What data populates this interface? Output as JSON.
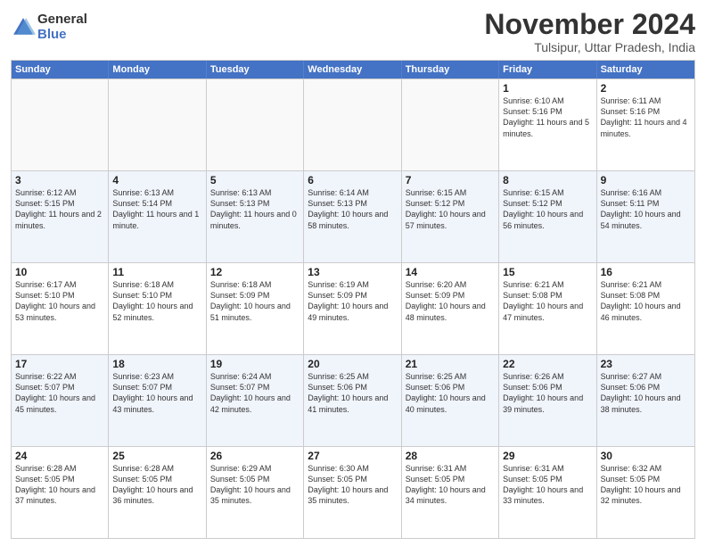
{
  "header": {
    "logo_general": "General",
    "logo_blue": "Blue",
    "month_title": "November 2024",
    "location": "Tulsipur, Uttar Pradesh, India"
  },
  "days_of_week": [
    "Sunday",
    "Monday",
    "Tuesday",
    "Wednesday",
    "Thursday",
    "Friday",
    "Saturday"
  ],
  "rows": [
    {
      "alt": false,
      "cells": [
        {
          "day": "",
          "empty": true
        },
        {
          "day": "",
          "empty": true
        },
        {
          "day": "",
          "empty": true
        },
        {
          "day": "",
          "empty": true
        },
        {
          "day": "",
          "empty": true
        },
        {
          "day": "1",
          "sunrise": "Sunrise: 6:10 AM",
          "sunset": "Sunset: 5:16 PM",
          "daylight": "Daylight: 11 hours and 5 minutes."
        },
        {
          "day": "2",
          "sunrise": "Sunrise: 6:11 AM",
          "sunset": "Sunset: 5:16 PM",
          "daylight": "Daylight: 11 hours and 4 minutes."
        }
      ]
    },
    {
      "alt": true,
      "cells": [
        {
          "day": "3",
          "sunrise": "Sunrise: 6:12 AM",
          "sunset": "Sunset: 5:15 PM",
          "daylight": "Daylight: 11 hours and 2 minutes."
        },
        {
          "day": "4",
          "sunrise": "Sunrise: 6:13 AM",
          "sunset": "Sunset: 5:14 PM",
          "daylight": "Daylight: 11 hours and 1 minute."
        },
        {
          "day": "5",
          "sunrise": "Sunrise: 6:13 AM",
          "sunset": "Sunset: 5:13 PM",
          "daylight": "Daylight: 11 hours and 0 minutes."
        },
        {
          "day": "6",
          "sunrise": "Sunrise: 6:14 AM",
          "sunset": "Sunset: 5:13 PM",
          "daylight": "Daylight: 10 hours and 58 minutes."
        },
        {
          "day": "7",
          "sunrise": "Sunrise: 6:15 AM",
          "sunset": "Sunset: 5:12 PM",
          "daylight": "Daylight: 10 hours and 57 minutes."
        },
        {
          "day": "8",
          "sunrise": "Sunrise: 6:15 AM",
          "sunset": "Sunset: 5:12 PM",
          "daylight": "Daylight: 10 hours and 56 minutes."
        },
        {
          "day": "9",
          "sunrise": "Sunrise: 6:16 AM",
          "sunset": "Sunset: 5:11 PM",
          "daylight": "Daylight: 10 hours and 54 minutes."
        }
      ]
    },
    {
      "alt": false,
      "cells": [
        {
          "day": "10",
          "sunrise": "Sunrise: 6:17 AM",
          "sunset": "Sunset: 5:10 PM",
          "daylight": "Daylight: 10 hours and 53 minutes."
        },
        {
          "day": "11",
          "sunrise": "Sunrise: 6:18 AM",
          "sunset": "Sunset: 5:10 PM",
          "daylight": "Daylight: 10 hours and 52 minutes."
        },
        {
          "day": "12",
          "sunrise": "Sunrise: 6:18 AM",
          "sunset": "Sunset: 5:09 PM",
          "daylight": "Daylight: 10 hours and 51 minutes."
        },
        {
          "day": "13",
          "sunrise": "Sunrise: 6:19 AM",
          "sunset": "Sunset: 5:09 PM",
          "daylight": "Daylight: 10 hours and 49 minutes."
        },
        {
          "day": "14",
          "sunrise": "Sunrise: 6:20 AM",
          "sunset": "Sunset: 5:09 PM",
          "daylight": "Daylight: 10 hours and 48 minutes."
        },
        {
          "day": "15",
          "sunrise": "Sunrise: 6:21 AM",
          "sunset": "Sunset: 5:08 PM",
          "daylight": "Daylight: 10 hours and 47 minutes."
        },
        {
          "day": "16",
          "sunrise": "Sunrise: 6:21 AM",
          "sunset": "Sunset: 5:08 PM",
          "daylight": "Daylight: 10 hours and 46 minutes."
        }
      ]
    },
    {
      "alt": true,
      "cells": [
        {
          "day": "17",
          "sunrise": "Sunrise: 6:22 AM",
          "sunset": "Sunset: 5:07 PM",
          "daylight": "Daylight: 10 hours and 45 minutes."
        },
        {
          "day": "18",
          "sunrise": "Sunrise: 6:23 AM",
          "sunset": "Sunset: 5:07 PM",
          "daylight": "Daylight: 10 hours and 43 minutes."
        },
        {
          "day": "19",
          "sunrise": "Sunrise: 6:24 AM",
          "sunset": "Sunset: 5:07 PM",
          "daylight": "Daylight: 10 hours and 42 minutes."
        },
        {
          "day": "20",
          "sunrise": "Sunrise: 6:25 AM",
          "sunset": "Sunset: 5:06 PM",
          "daylight": "Daylight: 10 hours and 41 minutes."
        },
        {
          "day": "21",
          "sunrise": "Sunrise: 6:25 AM",
          "sunset": "Sunset: 5:06 PM",
          "daylight": "Daylight: 10 hours and 40 minutes."
        },
        {
          "day": "22",
          "sunrise": "Sunrise: 6:26 AM",
          "sunset": "Sunset: 5:06 PM",
          "daylight": "Daylight: 10 hours and 39 minutes."
        },
        {
          "day": "23",
          "sunrise": "Sunrise: 6:27 AM",
          "sunset": "Sunset: 5:06 PM",
          "daylight": "Daylight: 10 hours and 38 minutes."
        }
      ]
    },
    {
      "alt": false,
      "cells": [
        {
          "day": "24",
          "sunrise": "Sunrise: 6:28 AM",
          "sunset": "Sunset: 5:05 PM",
          "daylight": "Daylight: 10 hours and 37 minutes."
        },
        {
          "day": "25",
          "sunrise": "Sunrise: 6:28 AM",
          "sunset": "Sunset: 5:05 PM",
          "daylight": "Daylight: 10 hours and 36 minutes."
        },
        {
          "day": "26",
          "sunrise": "Sunrise: 6:29 AM",
          "sunset": "Sunset: 5:05 PM",
          "daylight": "Daylight: 10 hours and 35 minutes."
        },
        {
          "day": "27",
          "sunrise": "Sunrise: 6:30 AM",
          "sunset": "Sunset: 5:05 PM",
          "daylight": "Daylight: 10 hours and 35 minutes."
        },
        {
          "day": "28",
          "sunrise": "Sunrise: 6:31 AM",
          "sunset": "Sunset: 5:05 PM",
          "daylight": "Daylight: 10 hours and 34 minutes."
        },
        {
          "day": "29",
          "sunrise": "Sunrise: 6:31 AM",
          "sunset": "Sunset: 5:05 PM",
          "daylight": "Daylight: 10 hours and 33 minutes."
        },
        {
          "day": "30",
          "sunrise": "Sunrise: 6:32 AM",
          "sunset": "Sunset: 5:05 PM",
          "daylight": "Daylight: 10 hours and 32 minutes."
        }
      ]
    }
  ]
}
